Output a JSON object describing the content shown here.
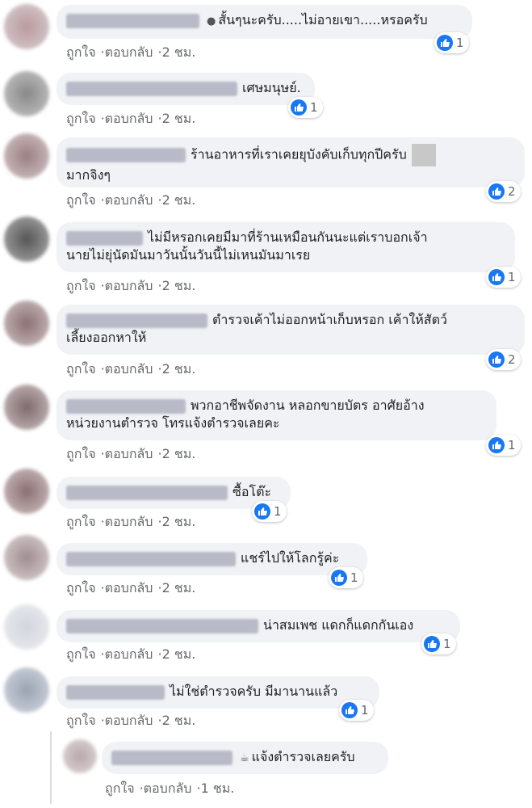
{
  "actions": {
    "like": "ถูกใจ",
    "reply": "ตอบกลับ",
    "separator": "·"
  },
  "comments": [
    {
      "text": "สั้นๆนะครับ.....ไม่อายเขา.....หรอครับ",
      "time": "2 ชม.",
      "likes": "1",
      "icon": "thinking-emoji-icon"
    },
    {
      "text": "เศษมนุษย์.",
      "time": "2 ชม.",
      "likes": "1"
    },
    {
      "text_line1": "ร้านอาหารที่เราเคยยุบังคับเก็บทุกปีครับ",
      "text_line2": "มากจิงๆ",
      "time": "2 ชม.",
      "likes": "2"
    },
    {
      "text_line1": "ไม่มีหรอกเคยมีมาที่ร้านเหมือนกันนะแต่เราบอกเจ้า",
      "text_line2": "นายไม่ยุ่นัดมันมาวันนั้นวันนี้ไม่เหนมันมาเรย",
      "time": "2 ชม.",
      "likes": "1"
    },
    {
      "text_line1": "ตำรวจเค้าไม่ออกหน้าเก็บหรอก เค้าให้สัตว์",
      "text_line2": "เลี้ยงออกหาให้",
      "time": "2 ชม.",
      "likes": "2"
    },
    {
      "text_line1": "พวกอาชีพจัดงาน หลอกขายบัตร อาศัยอ้าง",
      "text_line2": "หน่วยงานตำรวจ โทรแจ้งตำรวจเลยคะ",
      "time": "2 ชม.",
      "likes": "1"
    },
    {
      "text": "ซื้อโต๊ะ",
      "time": "2 ชม.",
      "likes": "1"
    },
    {
      "text": "แชร์ไปให้โลกรู้ค่ะ",
      "time": "2 ชม.",
      "likes": "1"
    },
    {
      "text": "น่าสมเพช แดกก็แดกกันเอง",
      "time": "2 ชม.",
      "likes": "1"
    },
    {
      "text": "ไม่ใช่ตำรวจครับ มีมานานแล้ว",
      "time": "2 ชม.",
      "likes": "1"
    },
    {
      "text": "แจ้งตำรวจเลยครับ",
      "time": "1 ชม.",
      "icon": "coffee-emoji-icon"
    }
  ]
}
